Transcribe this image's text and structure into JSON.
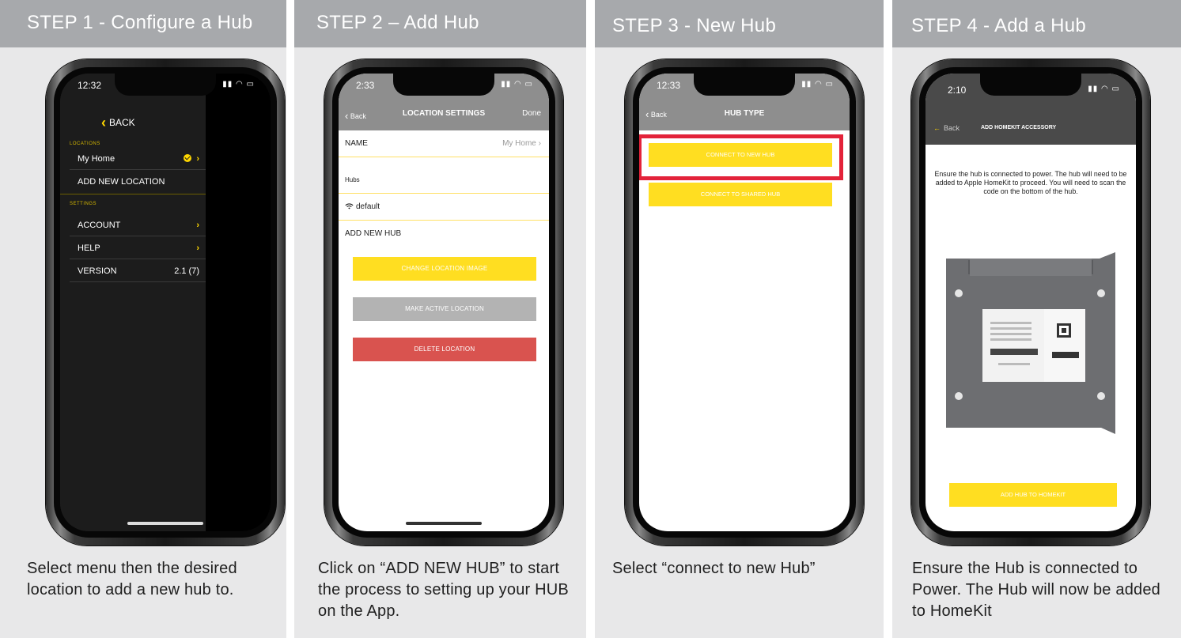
{
  "steps": [
    {
      "header": "STEP 1 - Configure a Hub",
      "caption": "Select menu then the desired location to add a new hub to.",
      "screen": {
        "status_time": "12:32",
        "back": "BACK",
        "locations_label": "LOCATIONS",
        "location_item": "My Home",
        "add_location": "ADD NEW LOCATION",
        "settings_label": "SETTINGS",
        "account": "ACCOUNT",
        "help": "HELP",
        "version_label": "VERSION",
        "version_value": "2.1 (7)"
      }
    },
    {
      "header": "STEP 2 – Add Hub",
      "caption": "Click on “ADD NEW HUB” to start the process to setting up your HUB on the App.",
      "screen": {
        "status_time": "2:33",
        "back": "Back",
        "title": "LOCATION SETTINGS",
        "done": "Done",
        "name_label": "NAME",
        "name_value": "My Home",
        "hubs_label": "Hubs",
        "hub_default": "default",
        "add_new_hub": "ADD NEW HUB",
        "change_image": "CHANGE LOCATION IMAGE",
        "make_active": "MAKE ACTIVE LOCATION",
        "delete": "DELETE LOCATION"
      }
    },
    {
      "header": "STEP 3 - New Hub",
      "caption": "Select “connect to new Hub”",
      "screen": {
        "status_time": "12:33",
        "back": "Back",
        "title": "HUB TYPE",
        "connect_new": "CONNECT TO NEW HUB",
        "connect_shared": "CONNECT TO SHARED HUB"
      }
    },
    {
      "header": "STEP 4 - Add a Hub",
      "caption": "Ensure the Hub is connected to Power. The Hub will now be added to HomeKit",
      "screen": {
        "status_time": "2:10",
        "back": "Back",
        "title": "ADD HOMEKIT ACCESSORY",
        "description": "Ensure the hub is connected to power. The hub will need to be added to Apple HomeKit to proceed. You will need to scan the code on the bottom of the hub.",
        "add_button": "ADD HUB TO HOMEKIT"
      }
    }
  ],
  "colors": {
    "header_bg": "#a7a9ac",
    "panel_bg": "#e8e8e9",
    "accent_yellow": "#ffde21",
    "delete_red": "#d9534f",
    "highlight_red": "#e3233a",
    "inactive_grey": "#b3b3b3"
  }
}
